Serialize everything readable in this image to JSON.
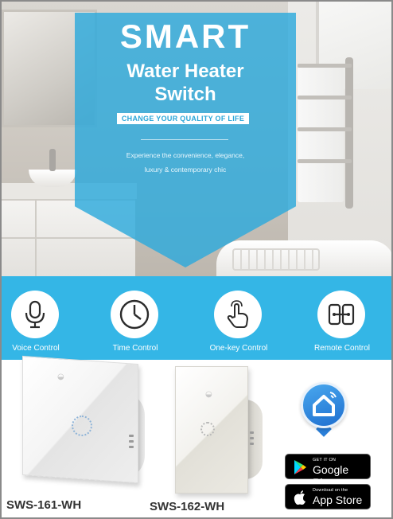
{
  "hero": {
    "title": "SMART",
    "subtitle_line1": "Water Heater",
    "subtitle_line2": "Switch",
    "tagline": "CHANGE YOUR QUALITY OF LIFE",
    "description_line1": "Experience the convenience, elegance,",
    "description_line2": "luxury & contemporary chic"
  },
  "features": [
    {
      "label": "Voice Control",
      "icon": "microphone-icon"
    },
    {
      "label": "Time Control",
      "icon": "clock-icon"
    },
    {
      "label": "One-key  Control",
      "icon": "touch-hand-icon"
    },
    {
      "label": "Remote  Control",
      "icon": "remote-link-icon"
    }
  ],
  "products": [
    {
      "model": "SWS-161-WH"
    },
    {
      "model": "SWS-162-WH"
    }
  ],
  "stores": {
    "google_small": "GET IT ON",
    "google_big": "Google Play",
    "apple_small": "Download on the",
    "apple_big": "App Store"
  },
  "colors": {
    "banner_blue": "#2daadc",
    "strip_blue": "#34b6e6",
    "white": "#ffffff",
    "model_text": "#333333"
  }
}
